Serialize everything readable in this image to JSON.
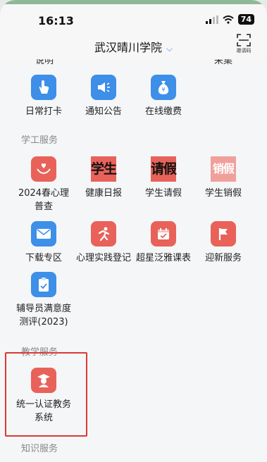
{
  "status_bar": {
    "time": "16:13",
    "battery": "74"
  },
  "header": {
    "title": "武汉晴川学院",
    "scan_label": "邀请码"
  },
  "cut_row": {
    "left": "说明",
    "right": "采集"
  },
  "row_top": [
    {
      "label": "日常打卡",
      "icon": "tap-hand-icon"
    },
    {
      "label": "通知公告",
      "icon": "megaphone-icon"
    },
    {
      "label": "在线缴费",
      "icon": "money-bag-icon"
    }
  ],
  "sections": {
    "student_affairs": "学工服务",
    "teaching": "教学服务",
    "knowledge": "知识服务"
  },
  "student_affairs_items": [
    {
      "label": "2024春心理普查",
      "icon": "heart-hands-icon"
    },
    {
      "label": "健康日报",
      "icon_text": "学生"
    },
    {
      "label": "学生请假",
      "icon_text": "请假"
    },
    {
      "label": "学生销假",
      "icon_text": "销假"
    },
    {
      "label": "下载专区",
      "icon": "envelope-icon"
    },
    {
      "label": "心理实践登记",
      "icon": "running-person-icon"
    },
    {
      "label": "超星泛雅课表",
      "icon": "calendar-icon"
    },
    {
      "label": "迎新服务",
      "icon": "flag-icon"
    },
    {
      "label": "辅导员满意度测评(2023)",
      "icon": "clipboard-icon"
    }
  ],
  "teaching_items": [
    {
      "label": "统一认证教务系统",
      "icon": "graduate-icon"
    }
  ],
  "colors": {
    "blue": "#3d8fe8",
    "red": "#e8625a",
    "highlight": "#d93a35"
  }
}
